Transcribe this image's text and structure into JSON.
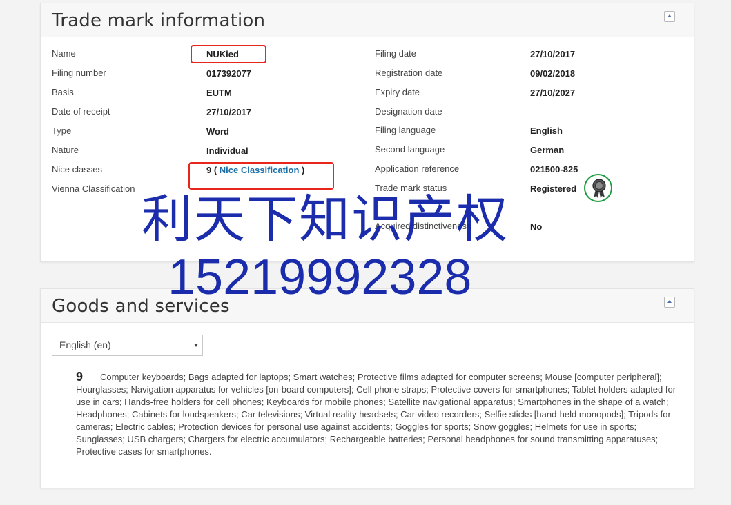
{
  "trademark": {
    "title": "Trade mark information",
    "left": [
      {
        "label": "Name",
        "value": "NUKied"
      },
      {
        "label": "Filing number",
        "value": "017392077"
      },
      {
        "label": "Basis",
        "value": "EUTM"
      },
      {
        "label": "Date of receipt",
        "value": "27/10/2017"
      },
      {
        "label": "Type",
        "value": "Word"
      },
      {
        "label": "Nature",
        "value": "Individual"
      },
      {
        "label": "Nice classes",
        "value": "9 (",
        "link": "Nice Classification",
        "suffix": ")"
      },
      {
        "label": "Vienna Classification",
        "value": ""
      }
    ],
    "right": [
      {
        "label": "Filing date",
        "value": "27/10/2017"
      },
      {
        "label": "Registration date",
        "value": "09/02/2018"
      },
      {
        "label": "Expiry date",
        "value": "27/10/2027"
      },
      {
        "label": "Designation date",
        "value": ""
      },
      {
        "label": "Filing language",
        "value": "English"
      },
      {
        "label": "Second language",
        "value": "German"
      },
      {
        "label": "Application reference",
        "value": "021500-825"
      },
      {
        "label": "Trade mark status",
        "value": "Registered"
      },
      {
        "label": "Acquired distinctiveness",
        "value": "No"
      }
    ],
    "status_icon": "award-ribbon-icon"
  },
  "watermark": {
    "line1": "利天下知识产权",
    "line2": "15219992328"
  },
  "goods": {
    "title": "Goods and services",
    "language_select": "English (en)",
    "class_number": "9",
    "class_text": "Computer keyboards; Bags adapted for laptops; Smart watches; Protective films adapted for computer screens; Mouse [computer peripheral]; Hourglasses; Navigation apparatus for vehicles [on-board computers]; Cell phone straps; Protective covers for smartphones; Tablet holders adapted for use in cars; Hands-free holders for cell phones; Keyboards for mobile phones; Satellite navigational apparatus; Smartphones in the shape of a watch; Headphones; Cabinets for loudspeakers; Car televisions; Virtual reality headsets; Car video recorders; Selfie sticks [hand-held monopods]; Tripods for cameras; Electric cables; Protection devices for personal use against accidents; Goggles for sports; Snow goggles; Helmets for use in sports; Sunglasses; USB chargers; Chargers for electric accumulators; Rechargeable batteries; Personal headphones for sound transmitting apparatuses; Protective cases for smartphones."
  },
  "colors": {
    "link": "#1a6fa8",
    "highlight_box": "#e8261c",
    "status_ring": "#1e9a3e",
    "watermark": "#0f22a8"
  }
}
